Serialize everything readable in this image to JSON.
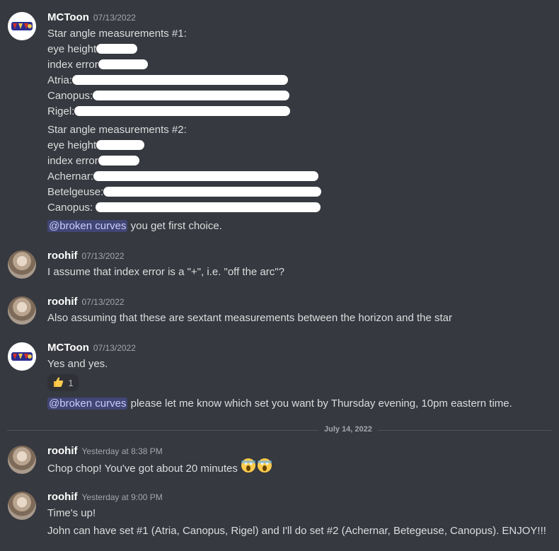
{
  "messages": [
    {
      "user": "MCToon",
      "timestamp": "07/13/2022",
      "lines": [
        "Star angle measurements #1:",
        "eye height",
        "index error",
        "Atria:",
        "Canopus:",
        "Rigel:",
        "Star angle measurements #2:",
        "eye height",
        "index error",
        "Achernar:",
        "Betelgeuse:",
        "Canopus:"
      ],
      "mention": "@broken curves",
      "mention_text": " you get first choice."
    },
    {
      "user": "roohif",
      "timestamp": "07/13/2022",
      "text": "I assume that index error is a \"+\", i.e. \"off the arc\"?"
    },
    {
      "user": "roohif",
      "timestamp": "07/13/2022",
      "text": "Also assuming that these are sextant measurements between the horizon and the star"
    },
    {
      "user": "MCToon",
      "timestamp": "07/13/2022",
      "text": "Yes and yes.",
      "reaction_count": "1",
      "mention": "@broken curves",
      "mention_text": " please let me know which set you want by Thursday evening, 10pm eastern time."
    },
    {
      "user": "roohif",
      "timestamp": "Yesterday at 8:38 PM",
      "text": "Chop chop! You've got about 20 minutes"
    },
    {
      "user": "roohif",
      "timestamp": "Yesterday at 9:00 PM",
      "text": "Time's up!",
      "text2": "John can have set #1 (Atria, Canopus, Rigel) and I'll do set #2 (Achernar, Betegeuse, Canopus). ENJOY!!!"
    }
  ],
  "divider_date": "July 14, 2022",
  "icons": {
    "reaction": "thumbs-up-icon",
    "emoji": "screaming-face-icon"
  },
  "colors": {
    "background": "#36393f",
    "mention_bg": "#414675",
    "mention_text": "#c9cdfb"
  }
}
